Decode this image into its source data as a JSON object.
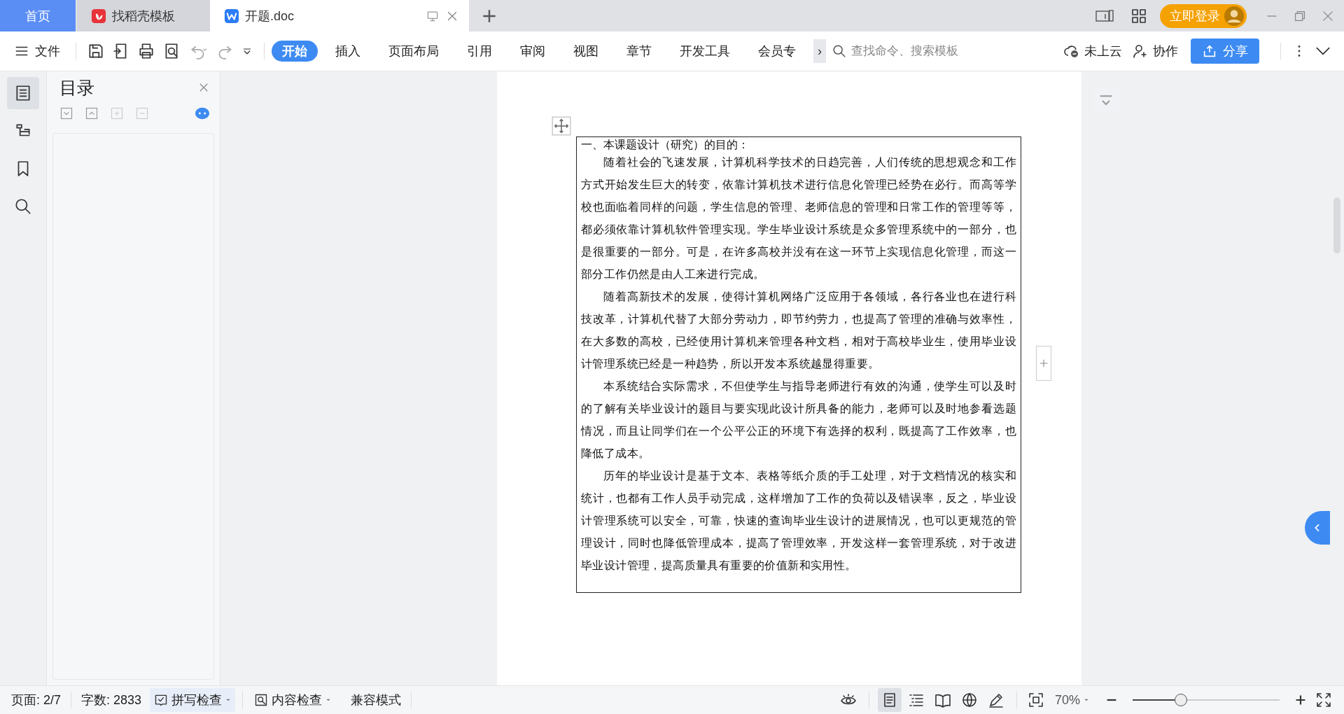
{
  "tabs": [
    {
      "label": "首页",
      "kind": "home",
      "selected": false
    },
    {
      "label": "找稻壳模板",
      "kind": "template",
      "selected": false
    },
    {
      "label": "开题.doc",
      "kind": "doc",
      "selected": true
    }
  ],
  "login_button": "立即登录",
  "file_menu": "文件",
  "ribbon_tabs": [
    {
      "label": "开始",
      "selected": true
    },
    {
      "label": "插入",
      "selected": false
    },
    {
      "label": "页面布局",
      "selected": false
    },
    {
      "label": "引用",
      "selected": false
    },
    {
      "label": "审阅",
      "selected": false
    },
    {
      "label": "视图",
      "selected": false
    },
    {
      "label": "章节",
      "selected": false
    },
    {
      "label": "开发工具",
      "selected": false
    },
    {
      "label": "会员专",
      "selected": false
    }
  ],
  "ribbon_more": "›",
  "search": {
    "placeholder": "查找命令、搜索模板"
  },
  "cloud_status": "未上云",
  "collaborate": "协作",
  "share_button": "分享",
  "side_tools": [
    {
      "kind": "outline",
      "selected": true
    },
    {
      "kind": "tree",
      "selected": false
    },
    {
      "kind": "bookmark",
      "selected": false
    },
    {
      "kind": "search",
      "selected": false
    }
  ],
  "toc_panel": {
    "title": "目录"
  },
  "document": {
    "heading": "一、本课题设计（研究）的目的：",
    "paragraphs": [
      "随着社会的飞速发展，计算机科学技术的日趋完善，人们传统的思想观念和工作方式开始发生巨大的转变，依靠计算机技术进行信息化管理已经势在必行。而高等学校也面临着同样的问题，学生信息的管理、老师信息的管理和日常工作的管理等等，都必须依靠计算机软件管理实现。学生毕业设计系统是众多管理系统中的一部分，也是很重要的一部分。可是，在许多高校并没有在这一环节上实现信息化管理，而这一部分工作仍然是由人工来进行完成。",
      "随着高新技术的发展，使得计算机网络广泛应用于各领域，各行各业也在进行科技改革，计算机代替了大部分劳动力，即节约劳力，也提高了管理的准确与效率性，在大多数的高校，已经使用计算机来管理各种文档，相对于高校毕业生，使用毕业设计管理系统已经是一种趋势，所以开发本系统越显得重要。",
      "本系统结合实际需求，不但使学生与指导老师进行有效的沟通，使学生可以及时的了解有关毕业设计的题目与要实现此设计所具备的能力，老师可以及时地参看选题情况，而且让同学们在一个公平公正的环境下有选择的权利，既提高了工作效率，也降低了成本。",
      "历年的毕业设计是基于文本、表格等纸介质的手工处理，对于文档情况的核实和统计，也都有工作人员手动完成，这样增加了工作的负荷以及错误率，反之，毕业设计管理系统可以安全，可靠，快速的查询毕业生设计的进展情况，也可以更规范的管理设计，同时也降低管理成本，提高了管理效率，开发这样一套管理系统，对于改进毕业设计管理，提高质量具有重要的价值新和实用性。"
    ]
  },
  "status_bar": {
    "page": "页面: 2/7",
    "word_count": "字数: 2833",
    "spell_check": "拼写检查",
    "content_check": "内容检查",
    "compat_mode": "兼容模式",
    "views": [
      {
        "kind": "eye",
        "selected": false
      },
      {
        "kind": "page",
        "selected": true
      },
      {
        "kind": "outline",
        "selected": false
      },
      {
        "kind": "book",
        "selected": false
      },
      {
        "kind": "web",
        "selected": false
      },
      {
        "kind": "pen",
        "selected": false
      }
    ],
    "zoom": "70%",
    "zoom_slider": {
      "level": 0.33
    }
  }
}
